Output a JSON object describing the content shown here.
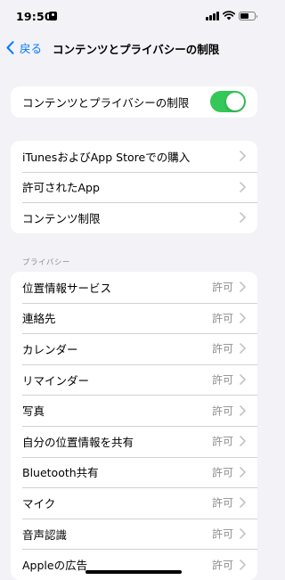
{
  "status_bar": {
    "time": "19:50"
  },
  "nav": {
    "back_label": "戻る",
    "title": "コンテンツとプライバシーの制限"
  },
  "toggle_group": {
    "label": "コンテンツとプライバシーの制限",
    "enabled": true
  },
  "store_group": {
    "items": [
      {
        "label": "iTunesおよびApp Storeでの購入"
      },
      {
        "label": "許可されたApp"
      },
      {
        "label": "コンテンツ制限"
      }
    ]
  },
  "privacy_section": {
    "header": "プライバシー",
    "items": [
      {
        "label": "位置情報サービス",
        "value": "許可"
      },
      {
        "label": "連絡先",
        "value": "許可"
      },
      {
        "label": "カレンダー",
        "value": "許可"
      },
      {
        "label": "リマインダー",
        "value": "許可"
      },
      {
        "label": "写真",
        "value": "許可"
      },
      {
        "label": "自分の位置情報を共有",
        "value": "許可"
      },
      {
        "label": "Bluetooth共有",
        "value": "許可"
      },
      {
        "label": "マイク",
        "value": "許可"
      },
      {
        "label": "音声認識",
        "value": "許可"
      },
      {
        "label": "Appleの広告",
        "value": "許可"
      }
    ]
  },
  "colors": {
    "accent": "#007aff",
    "toggle_on": "#34c759",
    "background": "#f2f2f7",
    "secondary_text": "#8e8e93"
  },
  "icons": [
    "back-chevron-icon",
    "chevron-right-icon",
    "signal-icon",
    "wifi-icon",
    "battery-icon",
    "person-badge-icon"
  ]
}
